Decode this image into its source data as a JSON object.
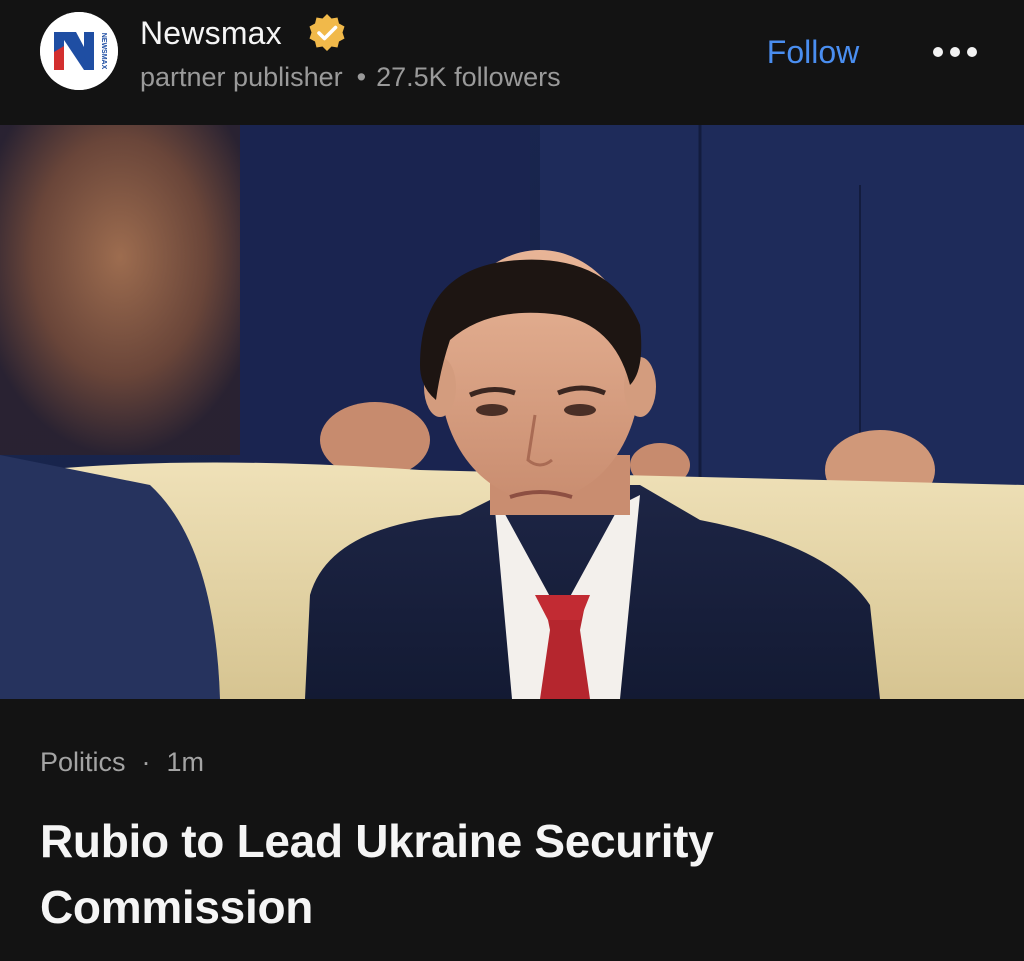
{
  "publisher": {
    "name": "Newsmax",
    "logo_text": "NEWSMAX",
    "logo_letter": "N",
    "verified": true,
    "badge_color": "#f1b94a",
    "role": "partner publisher",
    "separator": "•",
    "followers": "27.5K followers"
  },
  "actions": {
    "follow_label": "Follow",
    "follow_color": "#4a8ef0",
    "more_icon": "more-horizontal-icon"
  },
  "article": {
    "category": "Politics",
    "separator": "·",
    "age": "1m",
    "headline": "Rubio to Lead Ukraine Security Commission"
  },
  "colors": {
    "background": "#131313",
    "text_primary": "#f5f5f5",
    "text_secondary": "#9a9a9a"
  }
}
